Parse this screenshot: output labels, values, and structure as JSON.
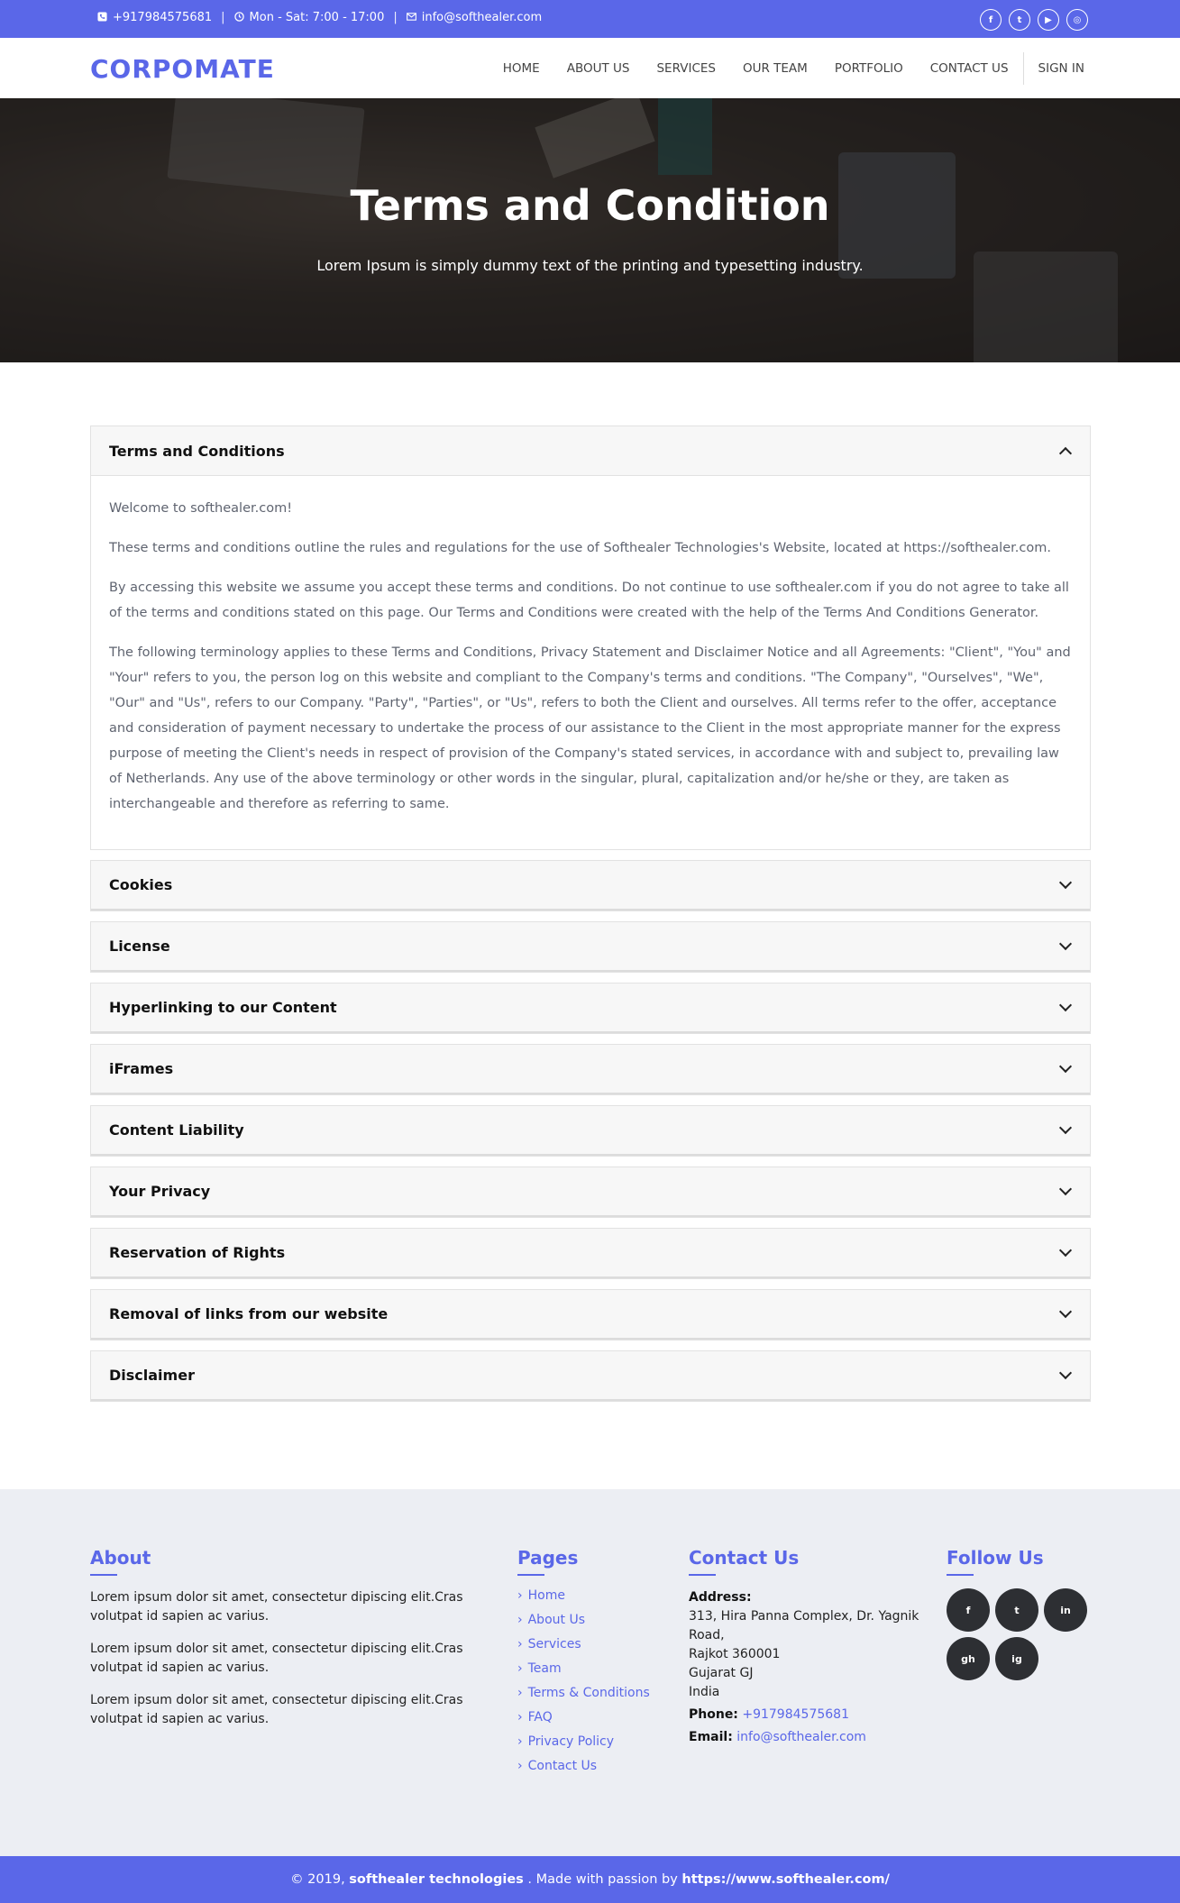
{
  "topbar": {
    "phone": "+917984575681",
    "hours": "Mon - Sat: 7:00 - 17:00",
    "email": "info@softhealer.com",
    "social": [
      "f",
      "t",
      "▶",
      "◎"
    ]
  },
  "nav": {
    "logo": "CORPOMATE",
    "items": [
      "HOME",
      "ABOUT US",
      "SERVICES",
      "OUR TEAM",
      "PORTFOLIO",
      "CONTACT US"
    ],
    "signin": "SIGN IN"
  },
  "hero": {
    "title": "Terms and Condition",
    "subtitle": "Lorem Ipsum is simply dummy text of the printing and typesetting industry."
  },
  "accordion": {
    "open": {
      "title": "Terms and Conditions",
      "paragraphs": [
        "Welcome to softhealer.com!",
        "These terms and conditions outline the rules and regulations for the use of Softhealer Technologies's Website, located at https://softhealer.com.",
        "By accessing this website we assume you accept these terms and conditions. Do not continue to use softhealer.com if you do not agree to take all of the terms and conditions stated on this page. Our Terms and Conditions were created with the help of the Terms And Conditions Generator.",
        "The following terminology applies to these Terms and Conditions, Privacy Statement and Disclaimer Notice and all Agreements: \"Client\", \"You\" and \"Your\" refers to you, the person log on this website and compliant to the Company's terms and conditions. \"The Company\", \"Ourselves\", \"We\", \"Our\" and \"Us\", refers to our Company. \"Party\", \"Parties\", or \"Us\", refers to both the Client and ourselves. All terms refer to the offer, acceptance and consideration of payment necessary to undertake the process of our assistance to the Client in the most appropriate manner for the express purpose of meeting the Client's needs in respect of provision of the Company's stated services, in accordance with and subject to, prevailing law of Netherlands. Any use of the above terminology or other words in the singular, plural, capitalization and/or he/she or they, are taken as interchangeable and therefore as referring to same."
      ]
    },
    "closed": [
      "Cookies",
      "License",
      "Hyperlinking to our Content",
      "iFrames",
      "Content Liability",
      "Your Privacy",
      "Reservation of Rights",
      "Removal of links from our website",
      "Disclaimer"
    ]
  },
  "footer": {
    "about": {
      "heading": "About",
      "paragraphs": [
        "Lorem ipsum dolor sit amet, consectetur dipiscing elit.Cras volutpat id sapien ac varius.",
        "Lorem ipsum dolor sit amet, consectetur dipiscing elit.Cras volutpat id sapien ac varius.",
        "Lorem ipsum dolor sit amet, consectetur dipiscing elit.Cras volutpat id sapien ac varius."
      ]
    },
    "pages": {
      "heading": "Pages",
      "links": [
        "Home",
        "About Us",
        "Services",
        "Team",
        "Terms & Conditions",
        "FAQ",
        "Privacy Policy",
        "Contact Us"
      ]
    },
    "contact": {
      "heading": "Contact Us",
      "address_label": "Address:",
      "address_lines": [
        "313, Hira Panna Complex, Dr. Yagnik",
        "Road,",
        "Rajkot 360001",
        "Gujarat GJ",
        "India"
      ],
      "phone_label": "Phone:",
      "phone": "+917984575681",
      "email_label": "Email:",
      "email": "info@softhealer.com"
    },
    "follow": {
      "heading": "Follow Us",
      "icons": [
        "f",
        "t",
        "in",
        "gh",
        "ig"
      ]
    }
  },
  "bottombar": {
    "prefix": "© 2019, ",
    "company": "softhealer technologies",
    "middle": " . Made with passion by ",
    "url": "https://www.softhealer.com/"
  }
}
